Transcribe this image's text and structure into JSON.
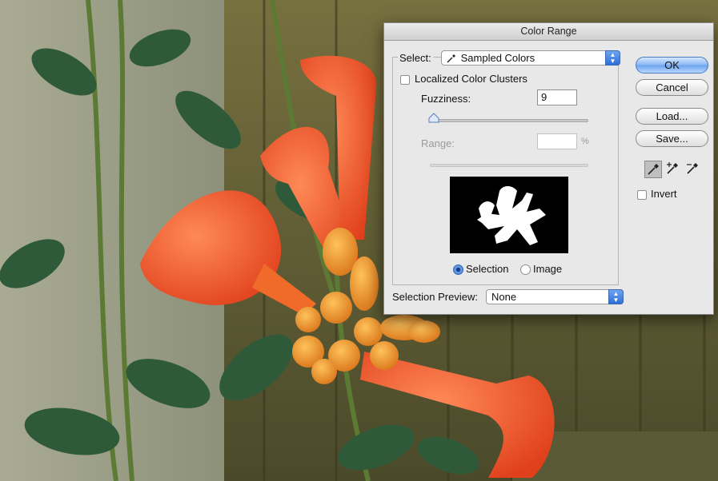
{
  "dialog": {
    "title": "Color Range",
    "select_label": "Select:",
    "select_value": "Sampled Colors",
    "localized_label": "Localized Color Clusters",
    "fuzziness_label": "Fuzziness:",
    "fuzziness_value": "9",
    "range_label": "Range:",
    "range_value": "",
    "range_unit": "%",
    "radio_selection": "Selection",
    "radio_image": "Image",
    "preview_label": "Selection Preview:",
    "preview_value": "None",
    "invert_label": "Invert",
    "buttons": {
      "ok": "OK",
      "cancel": "Cancel",
      "load": "Load...",
      "save": "Save..."
    }
  },
  "icons": [
    "eyedropper-icon",
    "eyedropper-plus-icon",
    "eyedropper-minus-icon"
  ],
  "colors": {
    "accent": "#6aa3ee",
    "dialog_bg": "#e8e8e8"
  }
}
